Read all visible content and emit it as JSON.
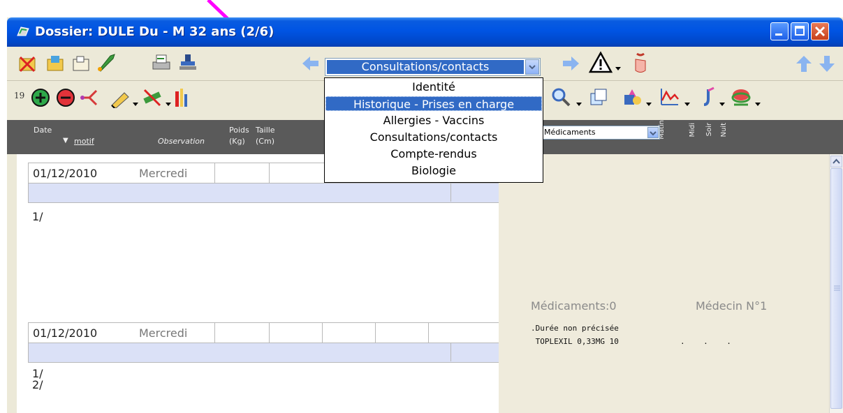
{
  "window": {
    "title": "Dossier: DULE Du - M 32 ans (2/6)"
  },
  "toolbar2": {
    "counter": "19"
  },
  "section_combo": {
    "selected": "Consultations/contacts",
    "options": [
      "Identité",
      "Historique - Prises en charge",
      "Allergies - Vaccins",
      "Consultations/contacts",
      "Compte-rendus",
      "Biologie"
    ],
    "highlighted_index": 1
  },
  "header": {
    "date": "Date",
    "motif": "motif",
    "observation": "Observation",
    "poids": "Poids",
    "poids_unit": "(Kg)",
    "taille": "Taille",
    "taille_unit": "(Cm)",
    "meds_select": "Médicaments",
    "matin": "Matin",
    "midi": "Midi",
    "soir": "Soir",
    "nuit": "Nuit"
  },
  "consultations": [
    {
      "date": "01/12/2010",
      "day": "Mercredi",
      "notes": [
        "1/"
      ]
    },
    {
      "date": "01/12/2010",
      "day": "Mercredi",
      "notes": [
        "1/",
        "2/"
      ]
    }
  ],
  "prescription": {
    "meds_count": "Médicaments:0",
    "doctor": "Médecin N°1",
    "duration": ".Durée non précisée",
    "drug": " TOPLEXIL 0,33MG 10",
    "dots": ".    .    ."
  },
  "annotation": {
    "arrow_color": "#ff00ff"
  }
}
